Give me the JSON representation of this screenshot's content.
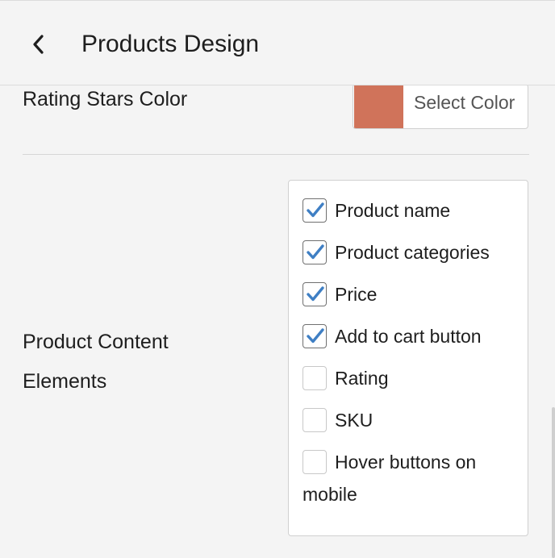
{
  "header": {
    "title": "Products Design",
    "back_icon": "chevron-left-icon"
  },
  "rating_stars": {
    "label": "Rating Stars Color",
    "swatch_color": "#d0735a",
    "button_label": "Select Color"
  },
  "content_elements": {
    "label_line1": "Product Content",
    "label_line2": "Elements",
    "options": [
      {
        "label": "Product name",
        "checked": true
      },
      {
        "label": "Product categories",
        "checked": true
      },
      {
        "label": "Price",
        "checked": true
      },
      {
        "label": "Add to cart button",
        "checked": true
      },
      {
        "label": "Rating",
        "checked": false
      },
      {
        "label": "SKU",
        "checked": false
      },
      {
        "label_line1": "Hover buttons on",
        "label_line2": "mobile",
        "checked": false
      }
    ]
  },
  "colors": {
    "check_mark": "#3f7fc4",
    "text": "#1e1e1e"
  }
}
